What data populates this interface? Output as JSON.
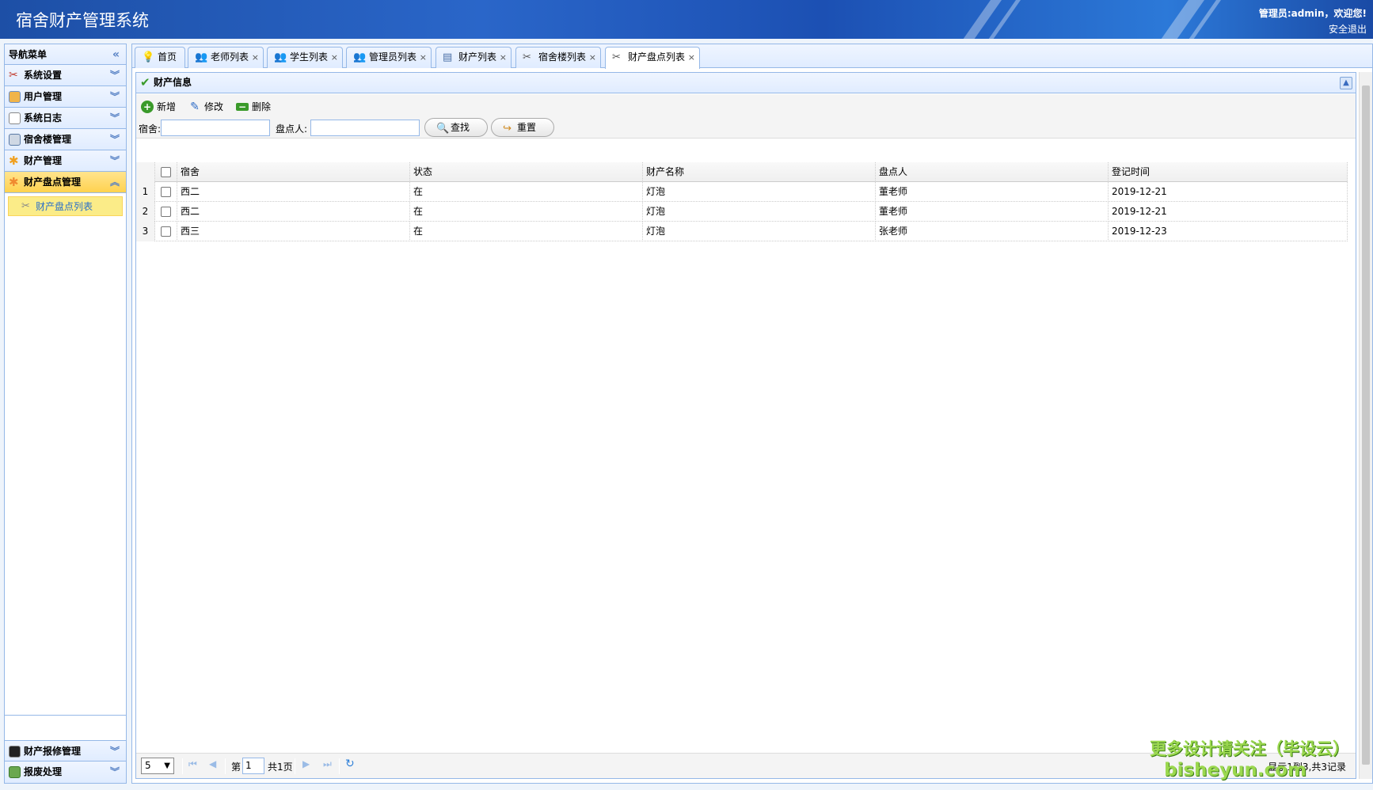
{
  "header": {
    "title": "宿舍财产管理系统",
    "user_greeting": "管理员:admin，欢迎您!",
    "logout": "安全退出"
  },
  "sidebar": {
    "title": "导航菜单",
    "items": [
      {
        "label": "系统设置",
        "icon": "tools-icon"
      },
      {
        "label": "用户管理",
        "icon": "user-icon"
      },
      {
        "label": "系统日志",
        "icon": "log-icon"
      },
      {
        "label": "宿舍楼管理",
        "icon": "building-icon"
      },
      {
        "label": "财产管理",
        "icon": "asset-icon"
      },
      {
        "label": "财产盘点管理",
        "icon": "inventory-icon"
      }
    ],
    "active_sub_item": "财产盘点列表",
    "bottom_items": [
      {
        "label": "财产报修管理",
        "icon": "terminal-icon"
      },
      {
        "label": "报废处理",
        "icon": "scrap-icon"
      }
    ]
  },
  "tabs": [
    {
      "label": "首页",
      "closable": false
    },
    {
      "label": "老师列表",
      "closable": true
    },
    {
      "label": "学生列表",
      "closable": true
    },
    {
      "label": "管理员列表",
      "closable": true
    },
    {
      "label": "财产列表",
      "closable": true
    },
    {
      "label": "宿舍楼列表",
      "closable": true
    },
    {
      "label": "财产盘点列表",
      "closable": true
    }
  ],
  "tab_close": "×",
  "panel": {
    "title": "财产信息"
  },
  "toolbar": {
    "add": "新增",
    "edit": "修改",
    "delete": "删除",
    "dorm_label": "宿舍:",
    "checker_label": "盘点人:",
    "dorm_value": "",
    "checker_value": "",
    "search": "查找",
    "reset": "重置"
  },
  "grid": {
    "columns": [
      "宿舍",
      "状态",
      "财产名称",
      "盘点人",
      "登记时间"
    ],
    "rows": [
      {
        "num": "1",
        "dorm": "西二",
        "status": "在",
        "asset": "灯泡",
        "checker": "董老师",
        "time": "2019-12-21"
      },
      {
        "num": "2",
        "dorm": "西二",
        "status": "在",
        "asset": "灯泡",
        "checker": "董老师",
        "time": "2019-12-21"
      },
      {
        "num": "3",
        "dorm": "西三",
        "status": "在",
        "asset": "灯泡",
        "checker": "张老师",
        "time": "2019-12-23"
      }
    ]
  },
  "pager": {
    "page_size": "5",
    "page_prefix": "第",
    "current_page": "1",
    "total_pages": "共1页",
    "info": "显示1到3,共3记录"
  },
  "watermark": {
    "line1": "更多设计请关注（毕设云）",
    "line2": "bisheyun.com"
  }
}
